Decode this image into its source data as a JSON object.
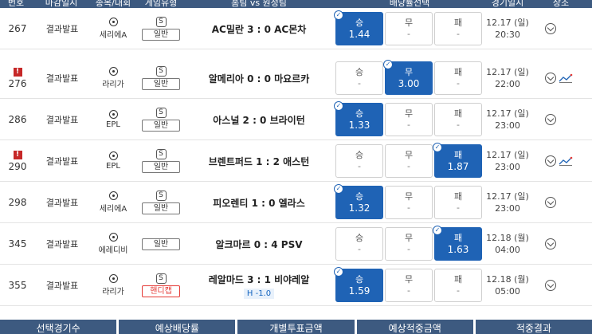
{
  "header": {
    "no": "번호",
    "close": "마감일시",
    "sport": "종목/대회",
    "type": "게임유형",
    "match": "홈팀 vs 원정팀",
    "odds": "배당률선택",
    "date": "경기일시",
    "detail": "상조"
  },
  "rows": [
    {
      "no": "267",
      "warn": false,
      "status": "결과발표",
      "league": "세리에A",
      "type_icon": "S",
      "type": "일반",
      "handicap": "",
      "match": "AC밀란 3 : 0 AC몬차",
      "win_label": "승",
      "win_val": "1.44",
      "draw_label": "무",
      "draw_val": "-",
      "lose_label": "패",
      "lose_val": "-",
      "selected": "win",
      "date": "12.17 (일)",
      "time": "20:30",
      "trend": false
    },
    {
      "no": "276",
      "warn": true,
      "status": "결과발표",
      "league": "라리가",
      "type_icon": "S",
      "type": "일반",
      "handicap": "",
      "match": "알메리아 0 : 0 마요르카",
      "win_label": "승",
      "win_val": "-",
      "draw_label": "무",
      "draw_val": "3.00",
      "lose_label": "패",
      "lose_val": "-",
      "selected": "draw",
      "date": "12.17 (일)",
      "time": "22:00",
      "trend": true
    },
    {
      "no": "286",
      "warn": false,
      "status": "결과발표",
      "league": "EPL",
      "type_icon": "S",
      "type": "일반",
      "handicap": "",
      "match": "아스널 2 : 0 브라이턴",
      "win_label": "승",
      "win_val": "1.33",
      "draw_label": "무",
      "draw_val": "-",
      "lose_label": "패",
      "lose_val": "-",
      "selected": "win",
      "date": "12.17 (일)",
      "time": "23:00",
      "trend": false
    },
    {
      "no": "290",
      "warn": true,
      "status": "결과발표",
      "league": "EPL",
      "type_icon": "S",
      "type": "일반",
      "handicap": "",
      "match": "브렌트퍼드 1 : 2 애스턴",
      "win_label": "승",
      "win_val": "-",
      "draw_label": "무",
      "draw_val": "-",
      "lose_label": "패",
      "lose_val": "1.87",
      "selected": "lose",
      "date": "12.17 (일)",
      "time": "23:00",
      "trend": true
    },
    {
      "no": "298",
      "warn": false,
      "status": "결과발표",
      "league": "세리에A",
      "type_icon": "S",
      "type": "일반",
      "handicap": "",
      "match": "피오렌티 1 : 0 엘라스",
      "win_label": "승",
      "win_val": "1.32",
      "draw_label": "무",
      "draw_val": "-",
      "lose_label": "패",
      "lose_val": "-",
      "selected": "win",
      "date": "12.17 (일)",
      "time": "23:00",
      "trend": false
    },
    {
      "no": "345",
      "warn": false,
      "status": "결과발표",
      "league": "에레디비",
      "type_icon": "",
      "type": "일반",
      "handicap": "",
      "match": "알크마르 0 : 4 PSV",
      "win_label": "승",
      "win_val": "-",
      "draw_label": "무",
      "draw_val": "-",
      "lose_label": "패",
      "lose_val": "1.63",
      "selected": "lose",
      "date": "12.18 (월)",
      "time": "04:00",
      "trend": false
    },
    {
      "no": "355",
      "warn": false,
      "status": "결과발표",
      "league": "라리가",
      "type_icon": "S",
      "type": "핸디캡",
      "handicap": "H -1.0",
      "match": "레알마드 3 : 1 비야레알",
      "win_label": "승",
      "win_val": "1.59",
      "draw_label": "무",
      "draw_val": "-",
      "lose_label": "패",
      "lose_val": "-",
      "selected": "win",
      "date": "12.18 (월)",
      "time": "05:00",
      "trend": false
    }
  ],
  "footer": {
    "f1": "선택경기수",
    "f2": "예상배당률",
    "f3": "개별투표금액",
    "f4": "예상적중금액",
    "f5": "적중결과"
  },
  "colors": {
    "header_bg": "#3d5a80",
    "selected_bg": "#1f63b5",
    "warn": "#c62828",
    "handicap_badge": "#e53935"
  }
}
